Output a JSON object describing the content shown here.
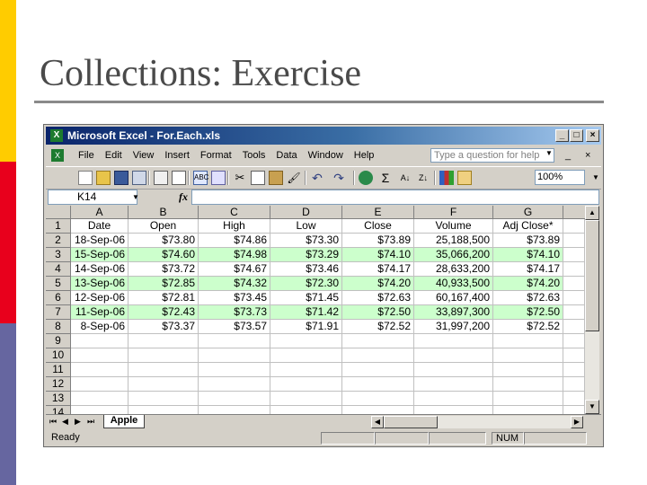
{
  "slide": {
    "title": "Collections: Exercise"
  },
  "window": {
    "title": "Microsoft Excel - For.Each.xls",
    "app_icon": "excel-icon",
    "controls": [
      "_",
      "□",
      "×"
    ]
  },
  "menubar": {
    "items": [
      "File",
      "Edit",
      "View",
      "Insert",
      "Format",
      "Tools",
      "Data",
      "Window",
      "Help"
    ],
    "help_placeholder": "Type a question for help",
    "doc_controls": [
      "_",
      "×"
    ]
  },
  "toolbar": {
    "zoom": "100%",
    "sigma": "Σ"
  },
  "formula_bar": {
    "name_box": "K14",
    "fx": "fx",
    "formula": ""
  },
  "sheet": {
    "columns": [
      "A",
      "B",
      "C",
      "D",
      "E",
      "F",
      "G"
    ],
    "row_numbers": [
      "1",
      "2",
      "3",
      "4",
      "5",
      "6",
      "7",
      "8",
      "9",
      "10",
      "11",
      "12",
      "13",
      "14"
    ],
    "headers": [
      "Date",
      "Open",
      "High",
      "Low",
      "Close",
      "Volume",
      "Adj Close*"
    ],
    "rows": [
      [
        "18-Sep-06",
        "$73.80",
        "$74.86",
        "$73.30",
        "$73.89",
        "25,188,500",
        "$73.89"
      ],
      [
        "15-Sep-06",
        "$74.60",
        "$74.98",
        "$73.29",
        "$74.10",
        "35,066,200",
        "$74.10"
      ],
      [
        "14-Sep-06",
        "$73.72",
        "$74.67",
        "$73.46",
        "$74.17",
        "28,633,200",
        "$74.17"
      ],
      [
        "13-Sep-06",
        "$72.85",
        "$74.32",
        "$72.30",
        "$74.20",
        "40,933,500",
        "$74.20"
      ],
      [
        "12-Sep-06",
        "$72.81",
        "$73.45",
        "$71.45",
        "$72.63",
        "60,167,400",
        "$72.63"
      ],
      [
        "11-Sep-06",
        "$72.43",
        "$73.73",
        "$71.42",
        "$72.50",
        "33,897,300",
        "$72.50"
      ],
      [
        "8-Sep-06",
        "$73.37",
        "$73.57",
        "$71.91",
        "$72.52",
        "31,997,200",
        "$72.52"
      ]
    ],
    "shade_color": "#ccffcc"
  },
  "tabs": {
    "active": "Apple",
    "nav": [
      "⏮",
      "◀",
      "▶",
      "⏭"
    ]
  },
  "statusbar": {
    "ready": "Ready",
    "num": "NUM"
  }
}
